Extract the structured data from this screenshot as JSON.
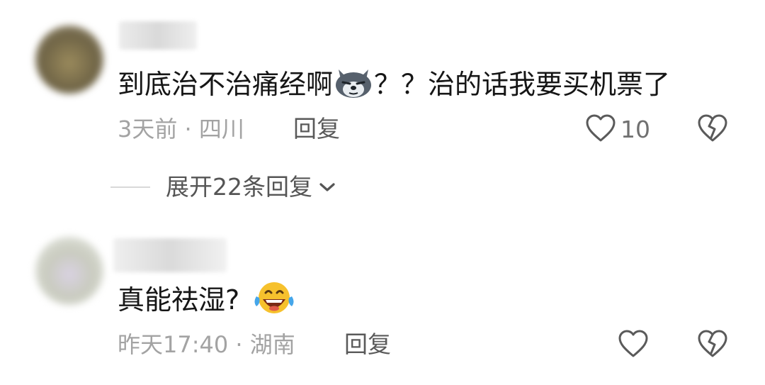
{
  "comments": [
    {
      "text_before": "到底治不治痛经啊",
      "text_after": "？？治的话我要买机票了",
      "emoji": "wolf-face-emoji",
      "meta": "3天前 · 四川",
      "reply_label": "回复",
      "likes": "10"
    },
    {
      "text_before": "真能祛湿?",
      "text_after": "",
      "emoji": "tears-of-joy-emoji",
      "meta": "昨天17:40 · 湖南",
      "reply_label": "回复",
      "likes": ""
    }
  ],
  "expand_replies": {
    "label": "展开22条回复"
  },
  "colors": {
    "text": "#161616",
    "meta": "#a3a3a3",
    "icon": "#5a5a5a"
  }
}
